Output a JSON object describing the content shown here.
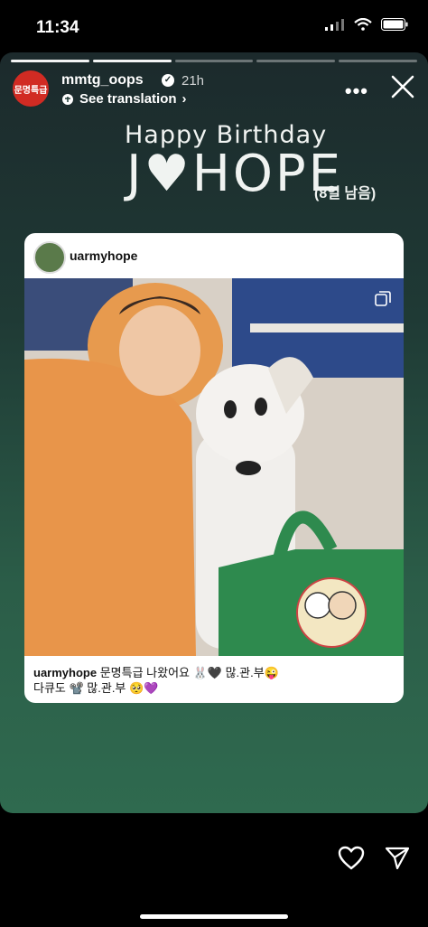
{
  "status": {
    "time": "11:34"
  },
  "story": {
    "progress_segments": 5,
    "progress_done": 2,
    "username": "mmtg_oops",
    "age": "21h",
    "translation_label": "See translation",
    "avatar_text": "문명특급"
  },
  "sticker": {
    "line1": "Happy Birthday",
    "line2": "J♥HOPE",
    "line3": "(8일 남음)"
  },
  "post": {
    "username": "uarmyhope",
    "caption_user": "uarmyhope",
    "caption_line1": "문명특급 나왔어요 🐰🖤 많.관.부😜",
    "caption_line2": "다큐도 📽️ 많.관.부 🥺💜"
  }
}
